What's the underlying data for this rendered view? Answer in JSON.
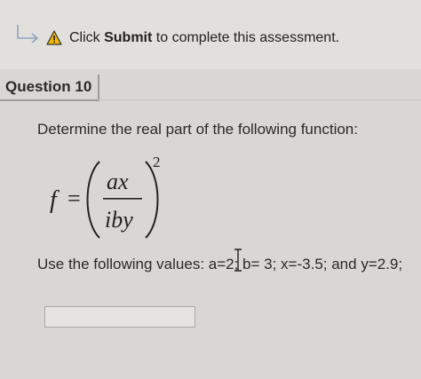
{
  "notice": {
    "prefix": "Click ",
    "strong": "Submit",
    "suffix": " to complete this assessment."
  },
  "question": {
    "title": "Question 10",
    "prompt": "Determine the real part of the following function:",
    "formula": {
      "lhs": "f",
      "equals": "=",
      "numerator": "ax",
      "denominator": "iby",
      "exponent": "2"
    },
    "values_text": "Use the following values: a=2; b= 3; x=-3.5; and y=2.9;"
  },
  "answer": {
    "value": ""
  },
  "colors": {
    "warning": "#f2b705",
    "arrow": "#8fa4bf"
  }
}
